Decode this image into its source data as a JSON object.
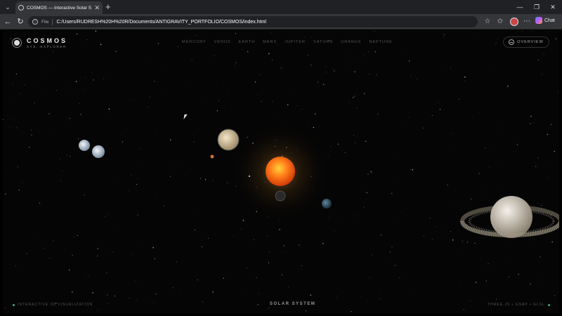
{
  "browser": {
    "tab_title": "COSMOS — Interactive Solar Syste",
    "scheme_label": "File",
    "url": "C:/Users/RUDRESH%20H%20R/Documents/ANTIGRAVITY_PORTFOLIO/COSMOS/index.html",
    "chat_label": "Chat"
  },
  "app": {
    "brand_name": "COSMOS",
    "brand_sub": "SYS. EXPLORER",
    "nav": [
      "MERCURY",
      "VENUS",
      "EARTH",
      "MARS",
      "JUPITER",
      "SATURN",
      "URANUS",
      "NEPTUNE"
    ],
    "overview_label": "OVERVIEW",
    "footer_left": "INTERACTIVE 3D VISUALIZATION",
    "footer_center": "SOLAR SYSTEM",
    "footer_right": "THREE.JS • GSAP • GLSL"
  },
  "colors": {
    "sun": "#ff6a1a",
    "accent_green": "#4caf7a",
    "background": "#050505"
  }
}
